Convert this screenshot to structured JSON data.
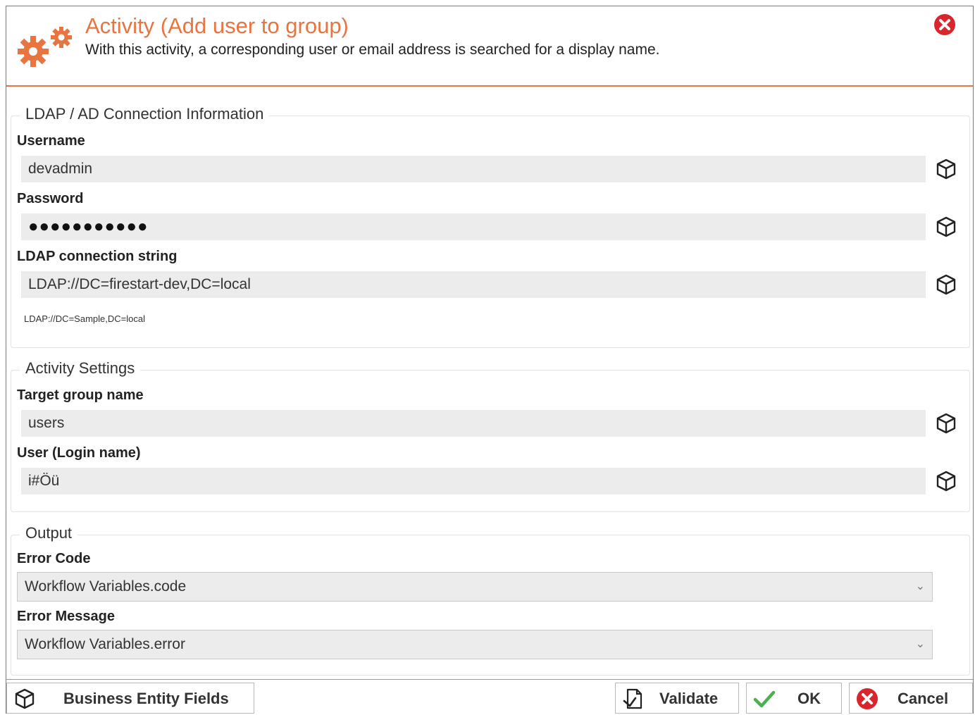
{
  "header": {
    "title": "Activity (Add user to group)",
    "subtitle": "With this activity, a corresponding user or email address is searched for a display name."
  },
  "ldap_group": {
    "legend": "LDAP / AD Connection Information",
    "username_label": "Username",
    "username_value": "devadmin",
    "password_label": "Password",
    "password_value": "●●●●●●●●●●●",
    "connection_label": "LDAP connection string",
    "connection_value": "LDAP://DC=firestart-dev,DC=local",
    "connection_hint": "LDAP://DC=Sample,DC=local"
  },
  "activity_group": {
    "legend": "Activity Settings",
    "target_label": "Target group name",
    "target_value": "users",
    "user_label": "User (Login name)",
    "user_value": "i#Öü"
  },
  "output_group": {
    "legend": "Output",
    "error_code_label": "Error Code",
    "error_code_value": "Workflow Variables.code",
    "error_message_label": "Error Message",
    "error_message_value": "Workflow Variables.error"
  },
  "footer": {
    "business_label": "Business Entity Fields",
    "validate_label": "Validate",
    "ok_label": "OK",
    "cancel_label": "Cancel"
  },
  "colors": {
    "accent": "#e8743f",
    "close_red": "#d9262c",
    "ok_green": "#4caf50",
    "input_bg": "#ececec"
  },
  "icons": {
    "header": "gears-icon",
    "close": "close-circle-icon",
    "field_action": "cube-icon",
    "validate": "validate-doc-icon",
    "ok": "checkmark-icon",
    "cancel": "cancel-circle-icon"
  }
}
